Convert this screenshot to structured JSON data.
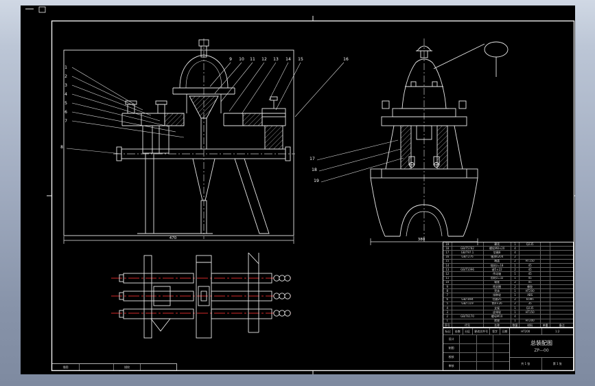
{
  "colors": {
    "bg_top": "#d0d8e4",
    "bg_bottom": "#7e8aa0",
    "sheet": "#000000",
    "line": "#e9e9e9",
    "centerline": "#c9c9c9",
    "red": "#d42a2a"
  },
  "callouts": {
    "left": [
      "1",
      "2",
      "3",
      "4",
      "5",
      "6",
      "7"
    ],
    "left_low": "8",
    "top": [
      "9",
      "10",
      "11",
      "12",
      "13",
      "14",
      "15"
    ],
    "mid": "16",
    "side": [
      "17",
      "18",
      "19"
    ]
  },
  "dims": {
    "front_width": "470",
    "side_width": "380"
  },
  "bom": {
    "headers": [
      "序号",
      "代号",
      "名称",
      "数量",
      "材料",
      "单重",
      "备注"
    ],
    "rows": [
      {
        "no": "19",
        "code": "",
        "name": "罩壳",
        "qty": "1",
        "mat": "Q235",
        "wt": "",
        "rem": ""
      },
      {
        "no": "18",
        "code": "GB/T5782",
        "name": "螺栓M8×20",
        "qty": "4",
        "mat": "",
        "wt": "",
        "rem": ""
      },
      {
        "no": "17",
        "code": "GB/T97.1",
        "name": "垫圈8",
        "qty": "4",
        "mat": "",
        "wt": "",
        "rem": ""
      },
      {
        "no": "16",
        "code": "GB/T276",
        "name": "轴承6204",
        "qty": "2",
        "mat": "",
        "wt": "",
        "rem": ""
      },
      {
        "no": "15",
        "code": "",
        "name": "端盖",
        "qty": "2",
        "mat": "HT150",
        "wt": "",
        "rem": ""
      },
      {
        "no": "14",
        "code": "",
        "name": "链轮z=18",
        "qty": "1",
        "mat": "45",
        "wt": "",
        "rem": ""
      },
      {
        "no": "13",
        "code": "GB/T1096",
        "name": "键5×22",
        "qty": "2",
        "mat": "45",
        "wt": "",
        "rem": ""
      },
      {
        "no": "12",
        "code": "",
        "name": "传动轴",
        "qty": "1",
        "mat": "45",
        "wt": "",
        "rem": ""
      },
      {
        "no": "11",
        "code": "",
        "name": "齿轮z=32",
        "qty": "1",
        "mat": "45",
        "wt": "",
        "rem": ""
      },
      {
        "no": "10",
        "code": "",
        "name": "轴套",
        "qty": "2",
        "mat": "45",
        "wt": "",
        "rem": ""
      },
      {
        "no": "9",
        "code": "",
        "name": "密封圈",
        "qty": "2",
        "mat": "橡胶",
        "wt": "",
        "rem": ""
      },
      {
        "no": "8",
        "code": "",
        "name": "壳体",
        "qty": "1",
        "mat": "HT200",
        "wt": "",
        "rem": ""
      },
      {
        "no": "7",
        "code": "",
        "name": "排种轮",
        "qty": "1",
        "mat": "ABS",
        "wt": "",
        "rem": ""
      },
      {
        "no": "6",
        "code": "GB/T894",
        "name": "挡圈25",
        "qty": "2",
        "mat": "65Mn",
        "wt": "",
        "rem": ""
      },
      {
        "no": "5",
        "code": "GB/T119",
        "name": "销4×26",
        "qty": "2",
        "mat": "35",
        "wt": "",
        "rem": ""
      },
      {
        "no": "4",
        "code": "",
        "name": "支架",
        "qty": "1",
        "mat": "Q235",
        "wt": "",
        "rem": ""
      },
      {
        "no": "3",
        "code": "",
        "name": "皮带轮",
        "qty": "1",
        "mat": "HT150",
        "wt": "",
        "rem": ""
      },
      {
        "no": "2",
        "code": "GB/T6170",
        "name": "螺母M10",
        "qty": "4",
        "mat": "",
        "wt": "",
        "rem": ""
      },
      {
        "no": "1",
        "code": "",
        "name": "底座",
        "qty": "1",
        "mat": "HT200",
        "wt": "",
        "rem": ""
      }
    ]
  },
  "titleblock": {
    "change": [
      "标记",
      "处数",
      "分区",
      "更改文件号",
      "签字",
      "日期"
    ],
    "sign_labels": [
      "设计",
      "制图",
      "校核",
      "审核"
    ],
    "material": "HT200",
    "scale": "1:2",
    "title1": "总装配图",
    "title2": "ZP—00",
    "sheet_total": "共 1 张",
    "sheet_no": "第 1 张"
  },
  "strip": {
    "cells": [
      "描图",
      "",
      "描校",
      ""
    ]
  }
}
